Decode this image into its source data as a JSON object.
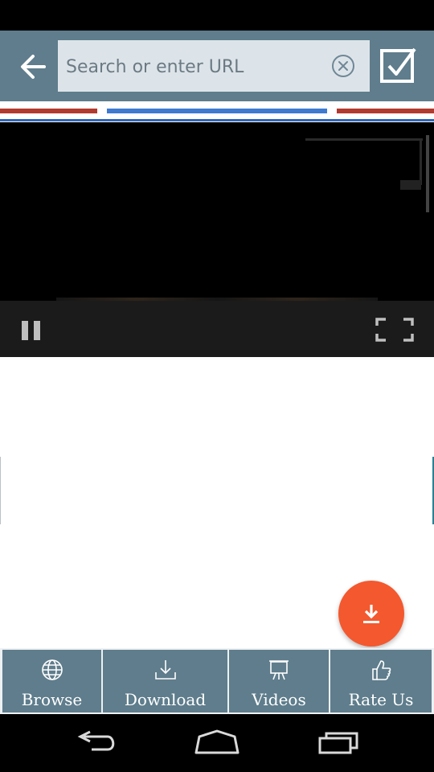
{
  "toolbar": {
    "url_placeholder": "Search or enter URL",
    "url_value": "",
    "back_icon": "arrow-left-icon",
    "clear_icon": "close-circle-icon",
    "confirm_icon": "checkbox-icon"
  },
  "colors": {
    "toolbar": "#5f7d8c",
    "accent_red": "#b23a2f",
    "accent_blue": "#3e7bd1",
    "fab": "#f4582e"
  },
  "video": {
    "state": "playing",
    "controls": [
      "pause-icon",
      "fullscreen-icon"
    ]
  },
  "fab": {
    "icon": "download-icon"
  },
  "bottom_nav": {
    "items": [
      {
        "label": "Browse",
        "icon": "globe-icon"
      },
      {
        "label": "Download",
        "icon": "download-tray-icon"
      },
      {
        "label": "Videos",
        "icon": "monitor-icon"
      },
      {
        "label": "Rate Us",
        "icon": "thumbs-up-icon"
      }
    ]
  },
  "system_nav": [
    "back-icon",
    "home-icon",
    "recents-icon"
  ]
}
